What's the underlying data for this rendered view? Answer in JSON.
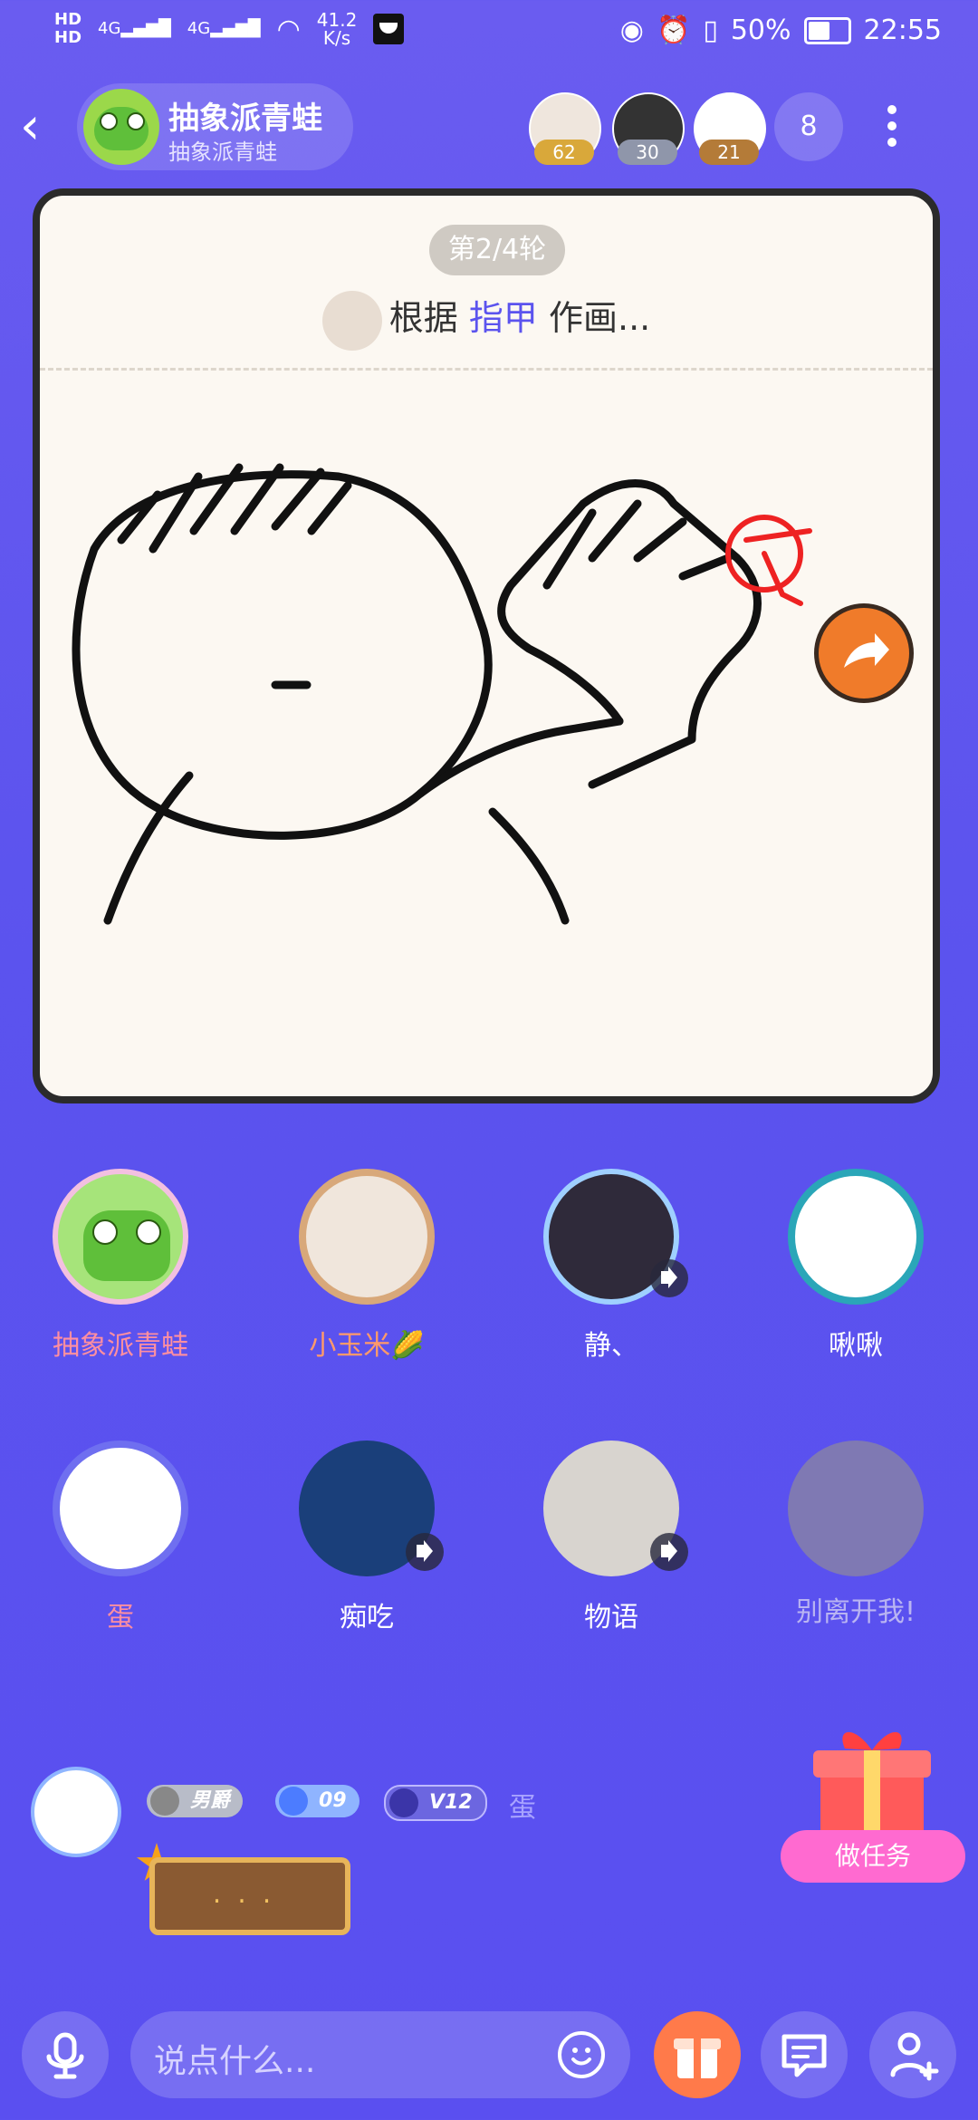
{
  "status_bar": {
    "hd1": "HD",
    "hd2": "HD",
    "sig1": "4G",
    "sig2": "4G",
    "speed_value": "41.2",
    "speed_unit": "K/s",
    "battery": "50%",
    "battery_level": 0.5,
    "time": "22:55"
  },
  "header": {
    "room_title": "抽象派青蛙",
    "room_subtitle": "抽象派青蛙",
    "top_users": [
      {
        "score": "62",
        "color": "#e5b73d"
      },
      {
        "score": "30",
        "color": "#9ba3b8"
      },
      {
        "score": "21",
        "color": "#c78a3f"
      }
    ],
    "online_count": "8"
  },
  "game": {
    "round": "第2/4轮",
    "prompt_before": "根据",
    "prompt_keyword": "指甲",
    "prompt_after": "作画..."
  },
  "seats": [
    {
      "name": "抽象派青蛙",
      "name_color": "#ff8fa0"
    },
    {
      "name": "小玉米🌽",
      "name_color": "#ff9a6a"
    },
    {
      "name": "静、",
      "name_color": "#ffffff"
    },
    {
      "name": "啾啾",
      "name_color": "#ffffff"
    },
    {
      "name": "蛋",
      "name_color": "#ff8fa0"
    },
    {
      "name": "痴吃",
      "name_color": "#ffffff"
    },
    {
      "name": "物语",
      "name_color": "#ffffff"
    },
    {
      "name": "别离开我!",
      "name_color": "#b9b4f2"
    }
  ],
  "chat": {
    "badge_gender": "男爵",
    "badge_level": "09",
    "badge_vip": "V12",
    "user_name": "蛋",
    "bubble_text": "..."
  },
  "task": {
    "label": "做任务"
  },
  "input": {
    "placeholder": "说点什么..."
  }
}
